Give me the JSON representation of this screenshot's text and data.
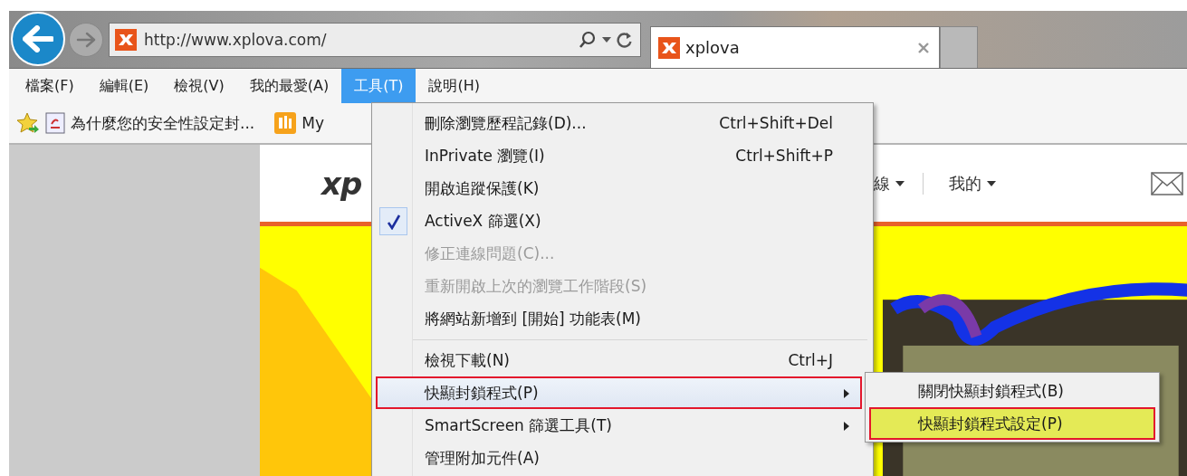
{
  "address_bar": {
    "url": "http://www.xplova.com/"
  },
  "tabs": [
    {
      "label": "xplova",
      "selected": true
    }
  ],
  "menu_bar": [
    {
      "label": "檔案(F)",
      "selected": false
    },
    {
      "label": "編輯(E)",
      "selected": false
    },
    {
      "label": "檢視(V)",
      "selected": false
    },
    {
      "label": "我的最愛(A)",
      "selected": false
    },
    {
      "label": "工具(T)",
      "selected": true
    },
    {
      "label": "說明(H)",
      "selected": false
    }
  ],
  "favorites_bar": [
    {
      "label": "為什麼您的安全性設定封...",
      "kind": "document"
    },
    {
      "label": "My",
      "kind": "app"
    }
  ],
  "page": {
    "logo": "xp",
    "nav": [
      {
        "label": "線"
      },
      {
        "label": "我的"
      }
    ]
  },
  "tools_menu": {
    "items": [
      {
        "kind": "item",
        "label": "刪除瀏覽歷程記錄(D)...",
        "shortcut": "Ctrl+Shift+Del",
        "checked": false,
        "disabled": false,
        "submenu": false,
        "highlighted": false,
        "outlined": false
      },
      {
        "kind": "item",
        "label": "InPrivate 瀏覽(I)",
        "shortcut": "Ctrl+Shift+P",
        "checked": false,
        "disabled": false,
        "submenu": false,
        "highlighted": false,
        "outlined": false
      },
      {
        "kind": "item",
        "label": "開啟追蹤保護(K)",
        "checked": false,
        "disabled": false,
        "submenu": false,
        "highlighted": false,
        "outlined": false
      },
      {
        "kind": "item",
        "label": "ActiveX 篩選(X)",
        "checked": true,
        "disabled": false,
        "submenu": false,
        "highlighted": false,
        "outlined": false
      },
      {
        "kind": "item",
        "label": "修正連線問題(C)...",
        "checked": false,
        "disabled": true,
        "submenu": false,
        "highlighted": false,
        "outlined": false
      },
      {
        "kind": "item",
        "label": "重新開啟上次的瀏覽工作階段(S)",
        "checked": false,
        "disabled": true,
        "submenu": false,
        "highlighted": false,
        "outlined": false
      },
      {
        "kind": "item",
        "label": "將網站新增到 [開始] 功能表(M)",
        "checked": false,
        "disabled": false,
        "submenu": false,
        "highlighted": false,
        "outlined": false
      },
      {
        "kind": "separator"
      },
      {
        "kind": "item",
        "label": "檢視下載(N)",
        "shortcut": "Ctrl+J",
        "checked": false,
        "disabled": false,
        "submenu": false,
        "highlighted": false,
        "outlined": false
      },
      {
        "kind": "item",
        "label": "快顯封鎖程式(P)",
        "checked": false,
        "disabled": false,
        "submenu": true,
        "highlighted": true,
        "outlined": true
      },
      {
        "kind": "item",
        "label": "SmartScreen 篩選工具(T)",
        "checked": false,
        "disabled": false,
        "submenu": true,
        "highlighted": false,
        "outlined": false
      },
      {
        "kind": "item",
        "label": "管理附加元件(A)",
        "checked": false,
        "disabled": false,
        "submenu": false,
        "highlighted": false,
        "outlined": false
      }
    ]
  },
  "submenu": {
    "items": [
      {
        "label": "關閉快顯封鎖程式(B)",
        "highlighted": false,
        "outlined": false
      },
      {
        "label": "快顯封鎖程式設定(P)",
        "highlighted": true,
        "outlined": true
      }
    ]
  }
}
